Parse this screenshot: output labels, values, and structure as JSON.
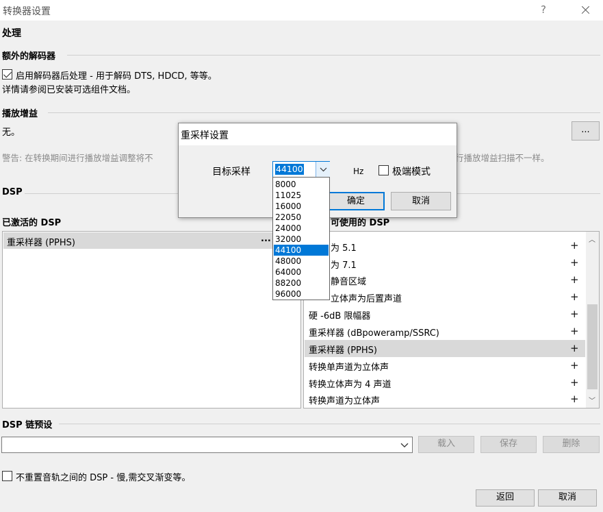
{
  "window": {
    "title": "转换器设置",
    "help_label": "?"
  },
  "processing": {
    "heading": "处理",
    "extra_decoders_title": "额外的解码器",
    "enable_postproc_label": "启用解码器后处理 - 用于解码 DTS, HDCD, 等等。",
    "enable_postproc_checked": true,
    "info_text": "详情请参阅已安装可选组件文档。"
  },
  "replaygain": {
    "title": "播放增益",
    "value": "无。",
    "browse_label": "...",
    "warning_left": "警告: 在转换期间进行播放增益调整将不",
    "warning_right": "行播放增益扫描不一样。"
  },
  "dsp": {
    "title": "DSP",
    "active_title": "已激活的 DSP",
    "active_items": [
      {
        "label": "重采样器 (PPHS)",
        "more": "..."
      }
    ],
    "available_title_partial": "可使用的 DSP",
    "available_items": [
      {
        "label": "为 5.1",
        "plus": "+"
      },
      {
        "label": "为 7.1",
        "plus": "+"
      },
      {
        "label": "静音区域",
        "plus": "+"
      },
      {
        "label": "立体声为后置声道",
        "plus": "+"
      },
      {
        "label": "硬 -6dB 限幅器",
        "plus": "+"
      },
      {
        "label": "重采样器 (dBpoweramp/SSRC)",
        "plus": "+"
      },
      {
        "label": "重采样器 (PPHS)",
        "plus": "+"
      },
      {
        "label": "转换单声道为立体声",
        "plus": "+"
      },
      {
        "label": "转换立体声为 4 声道",
        "plus": "+"
      },
      {
        "label": "转换声道为立体声",
        "plus": "+"
      }
    ],
    "available_selected_index": 6
  },
  "presets": {
    "title": "DSP 链预设",
    "combo_value": "",
    "load_label": "载入",
    "save_label": "保存",
    "delete_label": "删除"
  },
  "footer": {
    "no_reset_label": "不重置音轨之间的 DSP - 慢,需交叉渐变等。",
    "no_reset_checked": false,
    "back_label": "返回",
    "cancel_label": "取消"
  },
  "resample_dialog": {
    "title": "重采样设置",
    "target_label": "目标采样",
    "selected_rate": "44100",
    "unit_label": "Hz",
    "extreme_mode_label": "极端模式",
    "extreme_mode_checked": false,
    "ok_label": "确定",
    "cancel_label": "取消",
    "rate_options": [
      "8000",
      "11025",
      "16000",
      "22050",
      "24000",
      "32000",
      "44100",
      "48000",
      "64000",
      "88200",
      "96000"
    ],
    "selected_option_index": 6
  }
}
